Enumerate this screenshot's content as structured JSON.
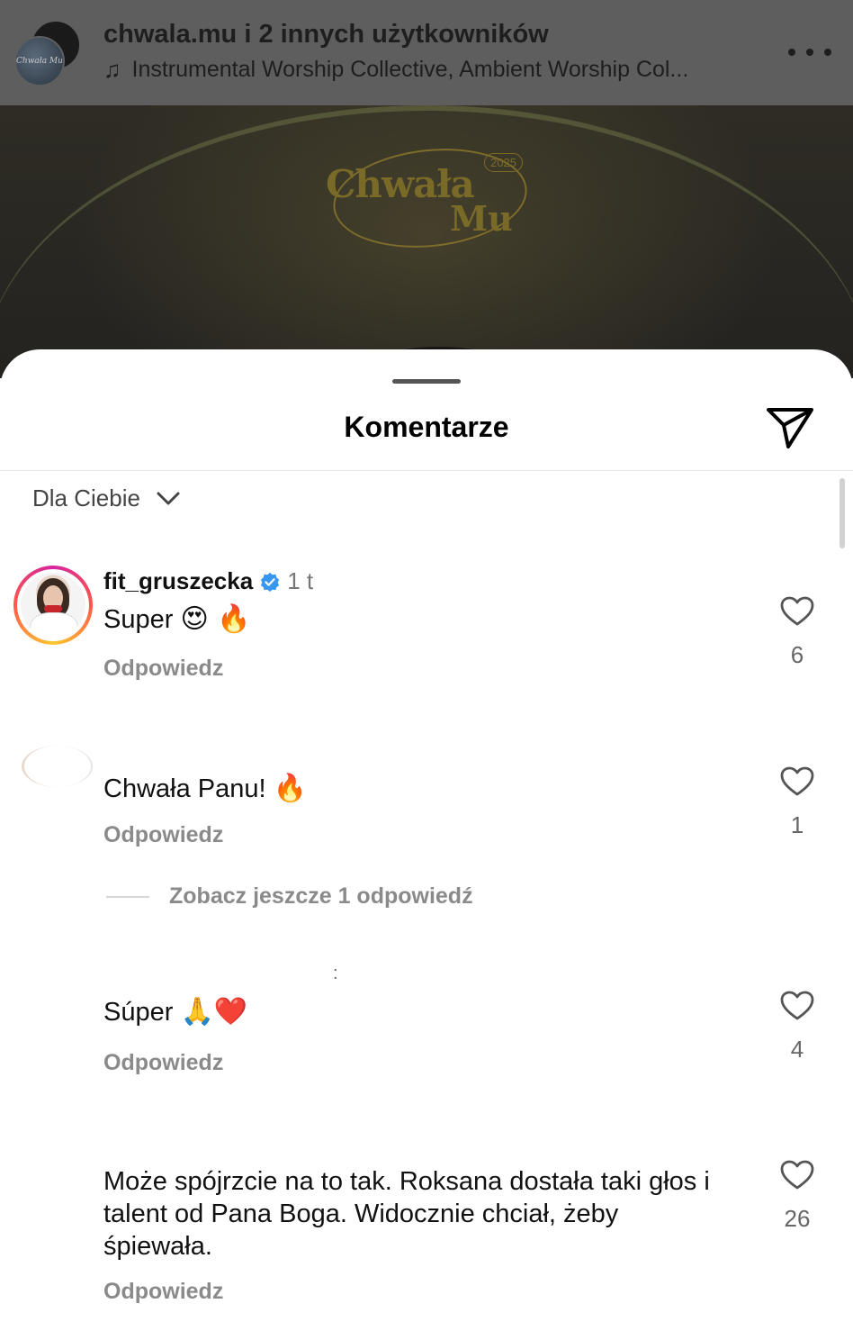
{
  "post": {
    "title": "chwala.mu i 2 innych użytkowników",
    "audio": "Instrumental Worship Collective, Ambient Worship Col...",
    "more_label": "Więcej",
    "art": {
      "title_line1": "Chwała",
      "title_line2": "Mu",
      "year": "2025"
    }
  },
  "sheet": {
    "title": "Komentarze",
    "filter_label": "Dla Ciebie"
  },
  "comments": [
    {
      "username": "fit_gruszecka",
      "verified": true,
      "time": "1 t",
      "text": "Super",
      "emojis": "😍 🔥",
      "reply": "Odpowiedz",
      "likes": "6"
    },
    {
      "username": "",
      "time": "",
      "text": "Chwała Panu!",
      "emojis": "🔥",
      "reply": "Odpowiedz",
      "likes": "1",
      "more_replies": "Zobacz jeszcze 1 odpowiedź"
    },
    {
      "username": "",
      "time": "",
      "text": "Súper",
      "emojis": "🙏❤️",
      "reply": "Odpowiedz",
      "likes": "4"
    },
    {
      "username": "",
      "time": "",
      "text": "Może spójrzcie na to tak. Roksana dostała taki głos i talent od Pana Boga. Widocznie chciał, żeby śpiewała.",
      "reply": "Odpowiedz",
      "likes": "26"
    }
  ],
  "colors": {
    "verified": "#3797f0",
    "sheet_bg": "#ffffff",
    "overlay": "#5e5e5e"
  },
  "icons": {
    "share": "send-icon",
    "like": "heart-icon",
    "audio": "music-note-icon",
    "filter": "chevron-down-icon"
  }
}
